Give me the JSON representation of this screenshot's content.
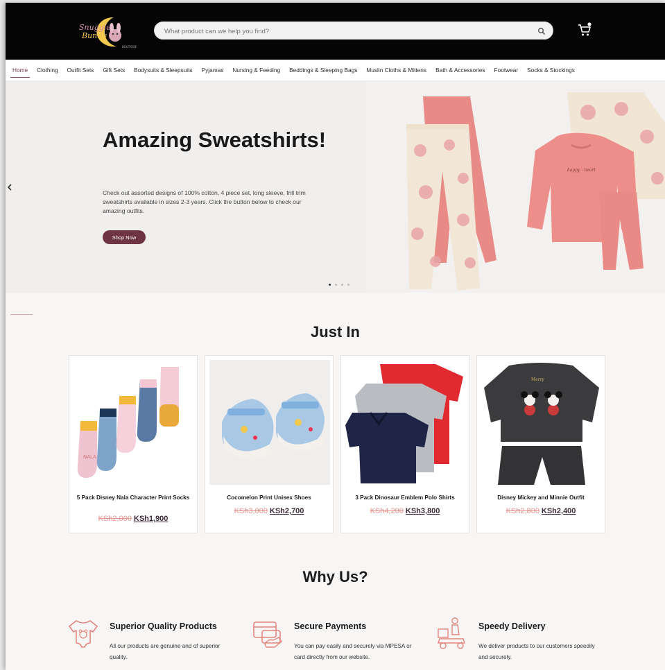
{
  "header": {
    "logo_text": "Snuggle Bunny",
    "search_placeholder": "What product can we help you find?",
    "search_icon": "search-icon",
    "cart_icon": "cart-icon"
  },
  "nav": {
    "items": [
      "Home",
      "Clothing",
      "Outfit Sets",
      "Gift Sets",
      "Bodysuits & Sleepsuits",
      "Pyjamas",
      "Nursing & Feeding",
      "Beddings & Sleeping Bags",
      "Muslin Cloths & Mittens",
      "Bath & Accessories",
      "Footwear",
      "Socks & Stockings"
    ],
    "active": "Home"
  },
  "hero": {
    "title": "Amazing Sweatshirts!",
    "description": "Check out assorted designs of 100% cotton, 4 piece set, long sleeve, frill trim sweatshirts available in sizes 2-3 years. Click the button below to check our amazing outfits.",
    "button": "Shop Now",
    "prev_icon": "chevron-left-icon",
    "slide_count": 4,
    "active_slide": 1
  },
  "just_in": {
    "title": "Just In",
    "products": [
      {
        "name": "5 Pack Disney Nala Character Print Socks",
        "old_price": "KSh2,000",
        "price": "KSh1,900"
      },
      {
        "name": "Cocomelon Print Unisex Shoes",
        "old_price": "KSh3,000",
        "price": "KSh2,700"
      },
      {
        "name": "3 Pack Dinosaur Emblem Polo Shirts",
        "old_price": "KSh4,200",
        "price": "KSh3,800"
      },
      {
        "name": "Disney Mickey and Minnie Outfit",
        "old_price": "KSh2,800",
        "price": "KSh2,400"
      }
    ]
  },
  "why_us": {
    "title": "Why Us?",
    "features": [
      {
        "title": "Superior Quality Products",
        "text": "All our products are genuine and of superior quality.",
        "icon": "baby-onesie-icon"
      },
      {
        "title": "Secure Payments",
        "text": "You can pay easily and securely via MPESA or card directly from our website.",
        "icon": "card-payment-icon"
      },
      {
        "title": "Speedy Delivery",
        "text": "We deliver products to our customers speedily and securely.",
        "icon": "delivery-scooter-icon"
      }
    ]
  },
  "colors": {
    "accent": "#6e3445",
    "old_price": "#e4948c",
    "icon_line": "#e3857f"
  }
}
